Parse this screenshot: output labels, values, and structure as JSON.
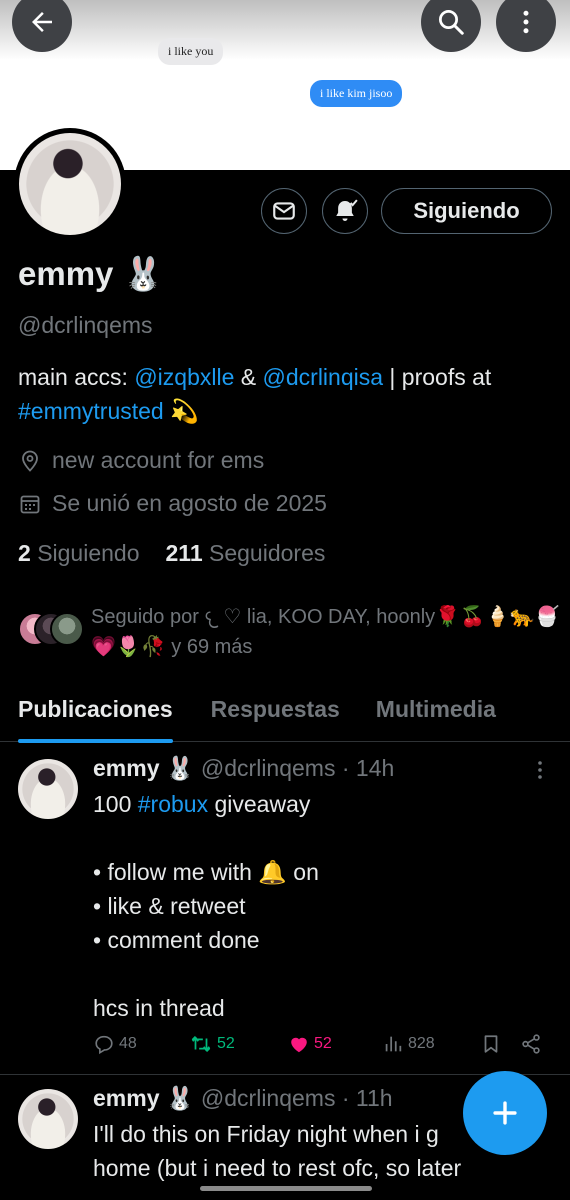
{
  "banner": {
    "bubble_received": "i like you",
    "bubble_sent": "i like kim jisoo"
  },
  "profile": {
    "follow_button_label": "Siguiendo",
    "display_name": "emmy 🐰",
    "handle": "@dcrlinqems",
    "bio": {
      "part1": "main accs: ",
      "mention1": "@izqbxlle",
      "part2": " & ",
      "mention2": "@dcrlinqisa",
      "part3": " | proofs at ",
      "hashtag": "#emmytrusted",
      "part4": " 💫"
    },
    "location": "new account for ems",
    "joined": "Se unió en agosto de 2025",
    "following_count": "2",
    "following_label": "Siguiendo",
    "followers_count": "211",
    "followers_label": "Seguidores",
    "followed_by": "Seguido por 𐔌 ♡ lia, KOO DAY, hoonly🌹🍒🍦🐆🍧💗🌷🥀 y 69 más"
  },
  "tabs": [
    {
      "label": "Publicaciones",
      "active": true
    },
    {
      "label": "Respuestas",
      "active": false
    },
    {
      "label": "Multimedia",
      "active": false
    }
  ],
  "posts": [
    {
      "name": "emmy 🐰",
      "meta": "@dcrlinqems · 14h",
      "text_prefix": "100 ",
      "text_hashtag": "#robux",
      "text_rest": " giveaway\n\n• follow me with 🔔 on\n• like & retweet\n• comment done\n\nhcs in thread",
      "replies": "48",
      "retweets": "52",
      "likes": "52",
      "views": "828"
    },
    {
      "name": "emmy 🐰",
      "meta": "@dcrlinqems · 11h",
      "text": "I'll do this on Friday night when i g\nhome (but i need to rest ofc, so later"
    }
  ],
  "colors": {
    "accent": "#1d9bf0",
    "background": "#000000",
    "secondary_text": "#71767b",
    "retweet": "#00ba7c",
    "like": "#f91880"
  }
}
